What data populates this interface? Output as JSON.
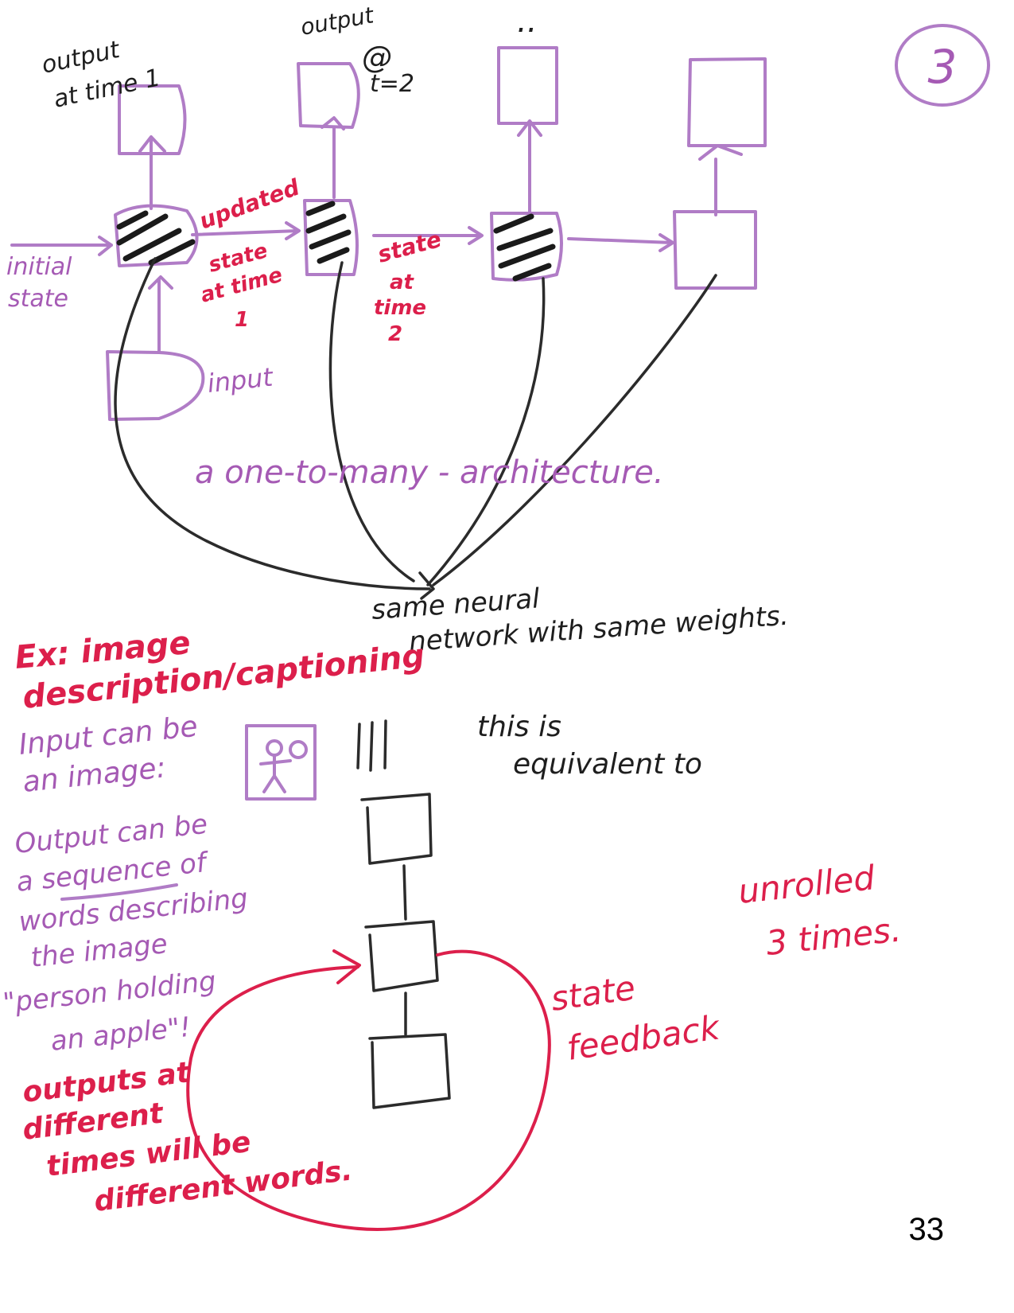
{
  "page": {
    "number": "33",
    "circled_number": "3"
  },
  "diagram": {
    "labels": {
      "output_time1": [
        "output",
        "at time 1"
      ],
      "output_t2": [
        "output",
        "@",
        "t=2"
      ],
      "output_dots": "..",
      "updated": "updated",
      "state_time1": [
        "state",
        "at time",
        "1"
      ],
      "state_time2": [
        "state",
        "at",
        "time",
        "2"
      ],
      "initial_state": [
        "initial",
        "state"
      ],
      "input": "input",
      "architecture": "a  one-to-many - architecture.",
      "same_weights": [
        "same neural",
        "network with same weights."
      ]
    }
  },
  "notes": {
    "example": [
      "Ex: image",
      "description/captioning"
    ],
    "input": [
      "Input can be",
      "an image:"
    ],
    "output": [
      "Output can be",
      "a sequence of",
      "words describing",
      "the image"
    ],
    "quote": [
      "\"person holding",
      "an apple\"!"
    ],
    "outputs_diff": [
      "outputs at",
      "different",
      "times will be",
      "different words."
    ],
    "equivalent": [
      "this is",
      "equivalent to"
    ],
    "unrolled": [
      "unrolled",
      "3 times."
    ],
    "feedback": [
      "state",
      "feedback"
    ]
  }
}
